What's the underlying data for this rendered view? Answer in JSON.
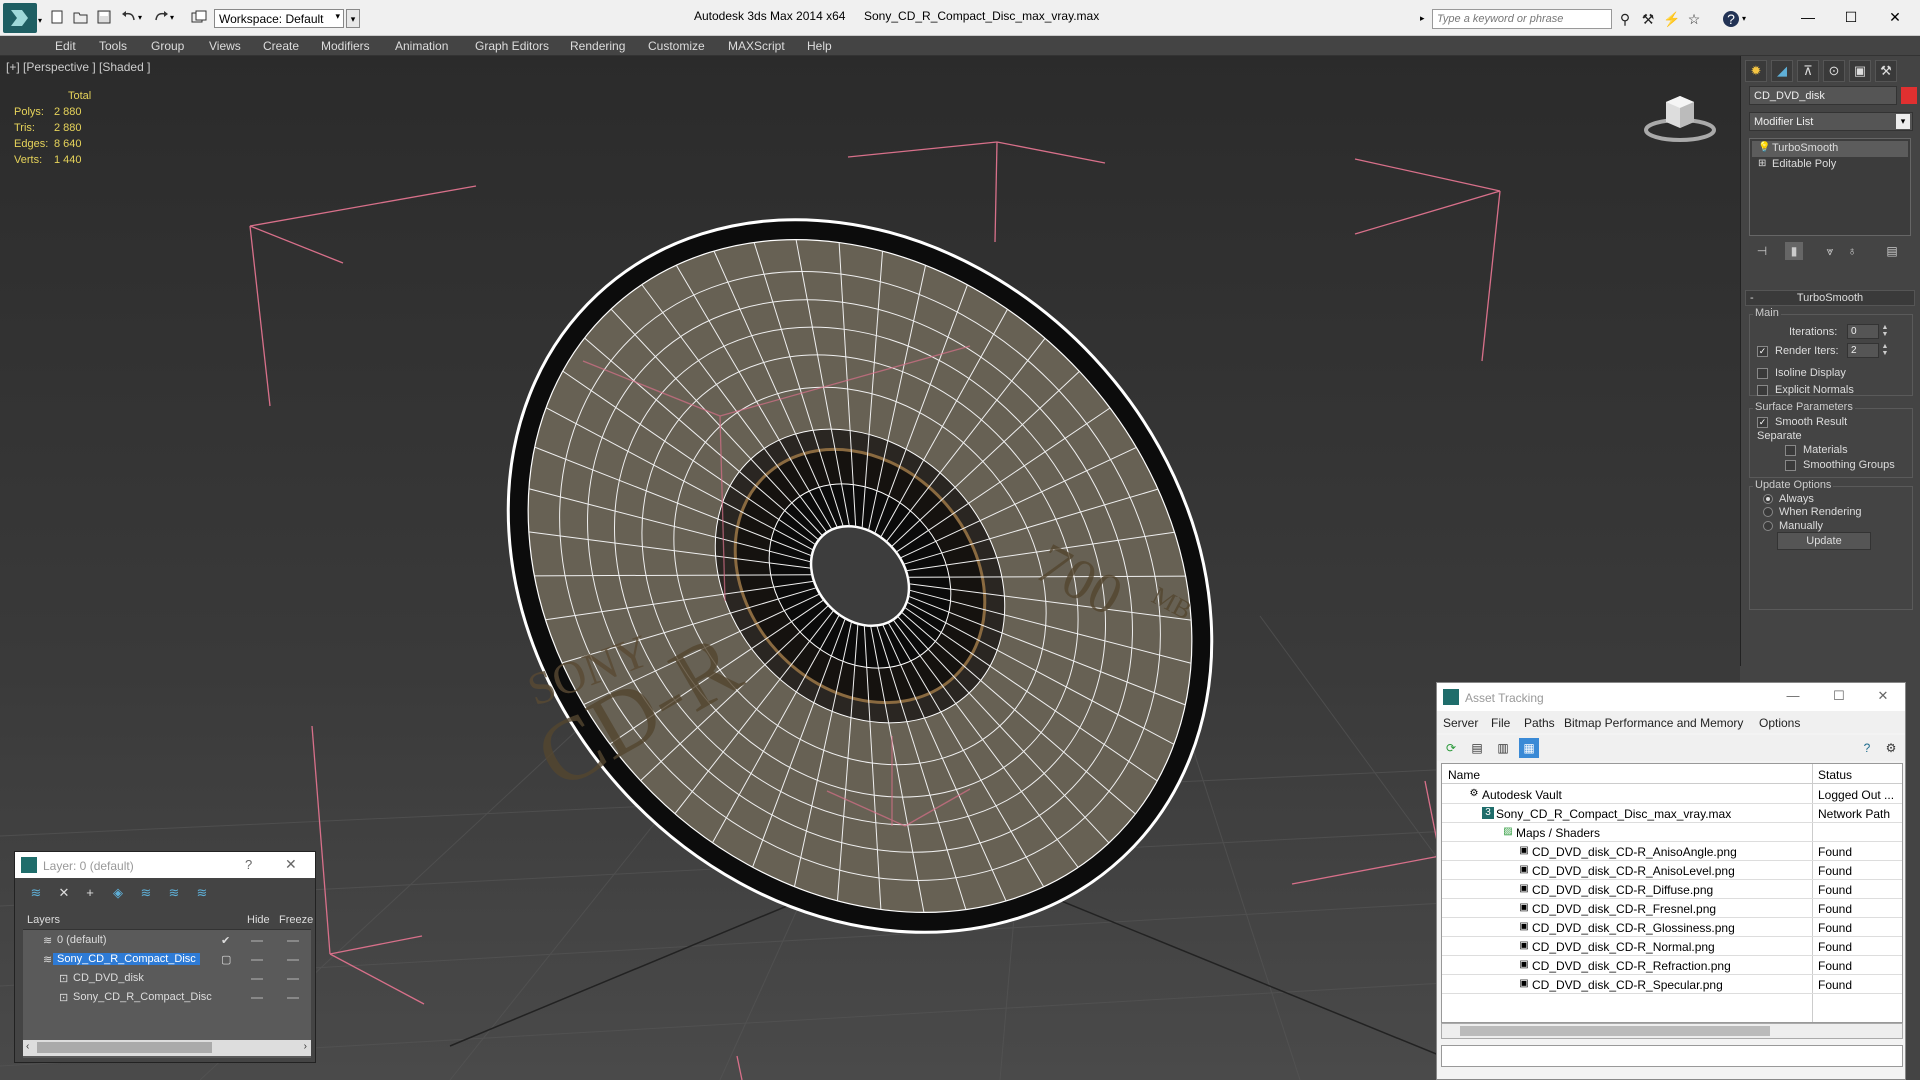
{
  "titlebar": {
    "workspace": "Workspace: Default",
    "app_title": "Autodesk 3ds Max  2014 x64",
    "file_title": "Sony_CD_R_Compact_Disc_max_vray.max",
    "search_placeholder": "Type a keyword or phrase"
  },
  "menu": [
    "Edit",
    "Tools",
    "Group",
    "Views",
    "Create",
    "Modifiers",
    "Animation",
    "Graph Editors",
    "Rendering",
    "Customize",
    "MAXScript",
    "Help"
  ],
  "viewport": {
    "label": "[+] [Perspective ] [Shaded ]",
    "stats_header": "Total",
    "stats": [
      {
        "label": "Polys:",
        "value": "2 880"
      },
      {
        "label": "Tris:",
        "value": "2 880"
      },
      {
        "label": "Edges:",
        "value": "8 640"
      },
      {
        "label": "Verts:",
        "value": "1 440"
      }
    ],
    "disc_text_1": "SONY",
    "disc_text_2": "CD-R",
    "disc_text_3": "700",
    "disc_text_4": "MB"
  },
  "command_panel": {
    "object_name": "CD_DVD_disk",
    "object_color": "#e03030",
    "modifier_list": "Modifier List",
    "stack": [
      "TurboSmooth",
      "Editable Poly"
    ],
    "rollout_title": "TurboSmooth",
    "main_group": "Main",
    "iterations_label": "Iterations:",
    "iterations_value": "0",
    "render_iters_label": "Render Iters:",
    "render_iters_value": "2",
    "isoline_label": "Isoline Display",
    "explicit_normals_label": "Explicit Normals",
    "surface_group": "Surface Parameters",
    "smooth_result_label": "Smooth Result",
    "separate_label": "Separate",
    "materials_label": "Materials",
    "smoothing_groups_label": "Smoothing Groups",
    "update_group": "Update Options",
    "always_label": "Always",
    "when_rendering_label": "When Rendering",
    "manually_label": "Manually",
    "update_button": "Update"
  },
  "asset_tracking": {
    "title": "Asset Tracking",
    "menu": [
      "Server",
      "File",
      "Paths",
      "Bitmap Performance and Memory",
      "Options"
    ],
    "col_name": "Name",
    "col_status": "Status",
    "rows": [
      {
        "name": "Autodesk Vault",
        "status": "Logged Out ..."
      },
      {
        "name": "Sony_CD_R_Compact_Disc_max_vray.max",
        "status": "Network Path"
      },
      {
        "name": "Maps / Shaders",
        "status": ""
      },
      {
        "name": "CD_DVD_disk_CD-R_AnisoAngle.png",
        "status": "Found"
      },
      {
        "name": "CD_DVD_disk_CD-R_AnisoLevel.png",
        "status": "Found"
      },
      {
        "name": "CD_DVD_disk_CD-R_Diffuse.png",
        "status": "Found"
      },
      {
        "name": "CD_DVD_disk_CD-R_Fresnel.png",
        "status": "Found"
      },
      {
        "name": "CD_DVD_disk_CD-R_Glossiness.png",
        "status": "Found"
      },
      {
        "name": "CD_DVD_disk_CD-R_Normal.png",
        "status": "Found"
      },
      {
        "name": "CD_DVD_disk_CD-R_Refraction.png",
        "status": "Found"
      },
      {
        "name": "CD_DVD_disk_CD-R_Specular.png",
        "status": "Found"
      }
    ]
  },
  "layer_window": {
    "title": "Layer: 0 (default)",
    "help": "?",
    "col_layers": "Layers",
    "col_hide": "Hide",
    "col_freeze": "Freeze",
    "rows": [
      {
        "name": "0 (default)"
      },
      {
        "name": "Sony_CD_R_Compact_Disc"
      },
      {
        "name": "CD_DVD_disk"
      },
      {
        "name": "Sony_CD_R_Compact_Disc"
      }
    ]
  }
}
